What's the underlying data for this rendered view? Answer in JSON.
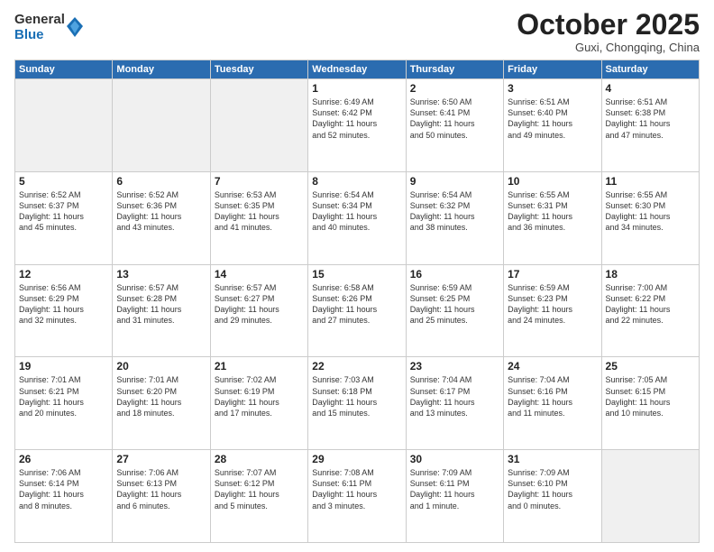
{
  "header": {
    "logo_general": "General",
    "logo_blue": "Blue",
    "month_title": "October 2025",
    "subtitle": "Guxi, Chongqing, China"
  },
  "weekdays": [
    "Sunday",
    "Monday",
    "Tuesday",
    "Wednesday",
    "Thursday",
    "Friday",
    "Saturday"
  ],
  "weeks": [
    [
      {
        "day": "",
        "text": ""
      },
      {
        "day": "",
        "text": ""
      },
      {
        "day": "",
        "text": ""
      },
      {
        "day": "1",
        "text": "Sunrise: 6:49 AM\nSunset: 6:42 PM\nDaylight: 11 hours\nand 52 minutes."
      },
      {
        "day": "2",
        "text": "Sunrise: 6:50 AM\nSunset: 6:41 PM\nDaylight: 11 hours\nand 50 minutes."
      },
      {
        "day": "3",
        "text": "Sunrise: 6:51 AM\nSunset: 6:40 PM\nDaylight: 11 hours\nand 49 minutes."
      },
      {
        "day": "4",
        "text": "Sunrise: 6:51 AM\nSunset: 6:38 PM\nDaylight: 11 hours\nand 47 minutes."
      }
    ],
    [
      {
        "day": "5",
        "text": "Sunrise: 6:52 AM\nSunset: 6:37 PM\nDaylight: 11 hours\nand 45 minutes."
      },
      {
        "day": "6",
        "text": "Sunrise: 6:52 AM\nSunset: 6:36 PM\nDaylight: 11 hours\nand 43 minutes."
      },
      {
        "day": "7",
        "text": "Sunrise: 6:53 AM\nSunset: 6:35 PM\nDaylight: 11 hours\nand 41 minutes."
      },
      {
        "day": "8",
        "text": "Sunrise: 6:54 AM\nSunset: 6:34 PM\nDaylight: 11 hours\nand 40 minutes."
      },
      {
        "day": "9",
        "text": "Sunrise: 6:54 AM\nSunset: 6:32 PM\nDaylight: 11 hours\nand 38 minutes."
      },
      {
        "day": "10",
        "text": "Sunrise: 6:55 AM\nSunset: 6:31 PM\nDaylight: 11 hours\nand 36 minutes."
      },
      {
        "day": "11",
        "text": "Sunrise: 6:55 AM\nSunset: 6:30 PM\nDaylight: 11 hours\nand 34 minutes."
      }
    ],
    [
      {
        "day": "12",
        "text": "Sunrise: 6:56 AM\nSunset: 6:29 PM\nDaylight: 11 hours\nand 32 minutes."
      },
      {
        "day": "13",
        "text": "Sunrise: 6:57 AM\nSunset: 6:28 PM\nDaylight: 11 hours\nand 31 minutes."
      },
      {
        "day": "14",
        "text": "Sunrise: 6:57 AM\nSunset: 6:27 PM\nDaylight: 11 hours\nand 29 minutes."
      },
      {
        "day": "15",
        "text": "Sunrise: 6:58 AM\nSunset: 6:26 PM\nDaylight: 11 hours\nand 27 minutes."
      },
      {
        "day": "16",
        "text": "Sunrise: 6:59 AM\nSunset: 6:25 PM\nDaylight: 11 hours\nand 25 minutes."
      },
      {
        "day": "17",
        "text": "Sunrise: 6:59 AM\nSunset: 6:23 PM\nDaylight: 11 hours\nand 24 minutes."
      },
      {
        "day": "18",
        "text": "Sunrise: 7:00 AM\nSunset: 6:22 PM\nDaylight: 11 hours\nand 22 minutes."
      }
    ],
    [
      {
        "day": "19",
        "text": "Sunrise: 7:01 AM\nSunset: 6:21 PM\nDaylight: 11 hours\nand 20 minutes."
      },
      {
        "day": "20",
        "text": "Sunrise: 7:01 AM\nSunset: 6:20 PM\nDaylight: 11 hours\nand 18 minutes."
      },
      {
        "day": "21",
        "text": "Sunrise: 7:02 AM\nSunset: 6:19 PM\nDaylight: 11 hours\nand 17 minutes."
      },
      {
        "day": "22",
        "text": "Sunrise: 7:03 AM\nSunset: 6:18 PM\nDaylight: 11 hours\nand 15 minutes."
      },
      {
        "day": "23",
        "text": "Sunrise: 7:04 AM\nSunset: 6:17 PM\nDaylight: 11 hours\nand 13 minutes."
      },
      {
        "day": "24",
        "text": "Sunrise: 7:04 AM\nSunset: 6:16 PM\nDaylight: 11 hours\nand 11 minutes."
      },
      {
        "day": "25",
        "text": "Sunrise: 7:05 AM\nSunset: 6:15 PM\nDaylight: 11 hours\nand 10 minutes."
      }
    ],
    [
      {
        "day": "26",
        "text": "Sunrise: 7:06 AM\nSunset: 6:14 PM\nDaylight: 11 hours\nand 8 minutes."
      },
      {
        "day": "27",
        "text": "Sunrise: 7:06 AM\nSunset: 6:13 PM\nDaylight: 11 hours\nand 6 minutes."
      },
      {
        "day": "28",
        "text": "Sunrise: 7:07 AM\nSunset: 6:12 PM\nDaylight: 11 hours\nand 5 minutes."
      },
      {
        "day": "29",
        "text": "Sunrise: 7:08 AM\nSunset: 6:11 PM\nDaylight: 11 hours\nand 3 minutes."
      },
      {
        "day": "30",
        "text": "Sunrise: 7:09 AM\nSunset: 6:11 PM\nDaylight: 11 hours\nand 1 minute."
      },
      {
        "day": "31",
        "text": "Sunrise: 7:09 AM\nSunset: 6:10 PM\nDaylight: 11 hours\nand 0 minutes."
      },
      {
        "day": "",
        "text": ""
      }
    ]
  ]
}
